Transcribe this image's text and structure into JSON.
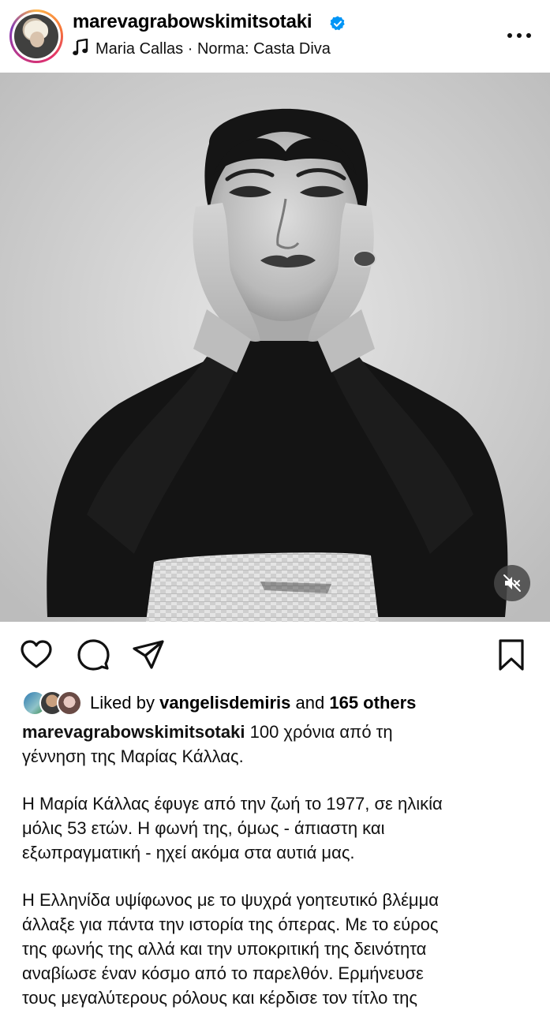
{
  "header": {
    "username": "marevagrabowskimitsotaki",
    "verified": true,
    "audio_artist": "Maria Callas",
    "audio_separator": "·",
    "audio_track": "Norma: Casta Diva",
    "more_icon": "more-horizontal-icon"
  },
  "photo": {
    "mute_icon": "speaker-muted-icon"
  },
  "actions": {
    "like_icon": "heart-icon",
    "comment_icon": "comment-icon",
    "share_icon": "send-icon",
    "save_icon": "bookmark-icon"
  },
  "likes": {
    "prefix": "Liked by",
    "user": "vangelisdemiris",
    "conjunction": "and",
    "others": "165 others"
  },
  "caption": {
    "username": "marevagrabowskimitsotaki",
    "first_text": "100 χρόνια από τη",
    "first_text_line2": "γέννηση της Μαρίας Κάλλας.",
    "para2_line1": "Η Μαρία Κάλλας έφυγε από την ζωή το 1977, σε ηλικία",
    "para2_line2": "μόλις 53 ετών. Η φωνή της, όμως - άπιαστη και",
    "para2_line3": "εξωπραγματική - ηχεί ακόμα στα αυτιά μας.",
    "para3_line1": "Η Ελληνίδα υψίφωνος με το ψυχρά γοητευτικό βλέμμα",
    "para3_line2": "άλλαξε για πάντα την ιστορία της όπερας. Με το εύρος",
    "para3_line3": "της φωνής της αλλά και την υποκριτική της δεινότητα",
    "para3_line4": "αναβίωσε έναν κόσμο από το παρελθόν. Ερμήνευσε",
    "para3_line5": "τους μεγαλύτερους ρόλους και κέρδισε τον τίτλο της"
  },
  "colors": {
    "verified_blue": "#0095f6",
    "text": "#000000"
  }
}
